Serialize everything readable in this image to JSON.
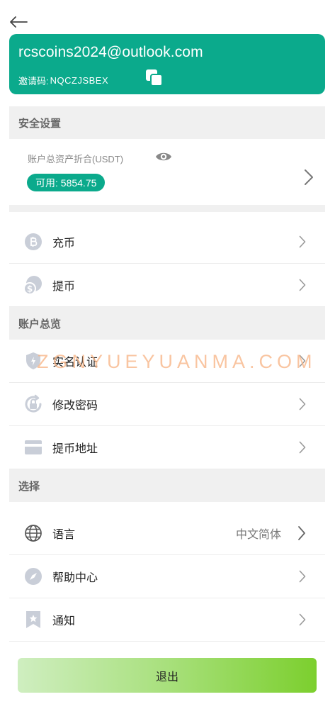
{
  "header": {
    "back_icon": "arrow-left-icon"
  },
  "account": {
    "email": "rcscoins2024@outlook.com",
    "invite_label": "邀请码:",
    "invite_code": "NQCZJSBEX",
    "copy_icon": "copy-icon"
  },
  "sections": {
    "security": "安全设置",
    "overview": "账户总览",
    "select": "选择"
  },
  "asset": {
    "label": "账户总资产折合(USDT)",
    "available": "可用: 5854.75"
  },
  "menu_security": [
    {
      "label": "充币",
      "icon": "coin-deposit-icon"
    },
    {
      "label": "提币",
      "icon": "coin-withdraw-icon"
    }
  ],
  "menu_overview": [
    {
      "label": "实名认证",
      "icon": "shield-icon"
    },
    {
      "label": "修改密码",
      "icon": "lock-refresh-icon"
    },
    {
      "label": "提币地址",
      "icon": "card-icon"
    }
  ],
  "menu_select": [
    {
      "label": "语言",
      "icon": "globe-icon",
      "value": "中文简体"
    },
    {
      "label": "帮助中心",
      "icon": "compass-icon"
    },
    {
      "label": "通知",
      "icon": "bookmark-star-icon"
    }
  ],
  "watermark": "ZGNYUEYUANMA.COM",
  "logout": "退出",
  "colors": {
    "accent": "#0baa8c",
    "section_bg": "#f0f0f0"
  }
}
